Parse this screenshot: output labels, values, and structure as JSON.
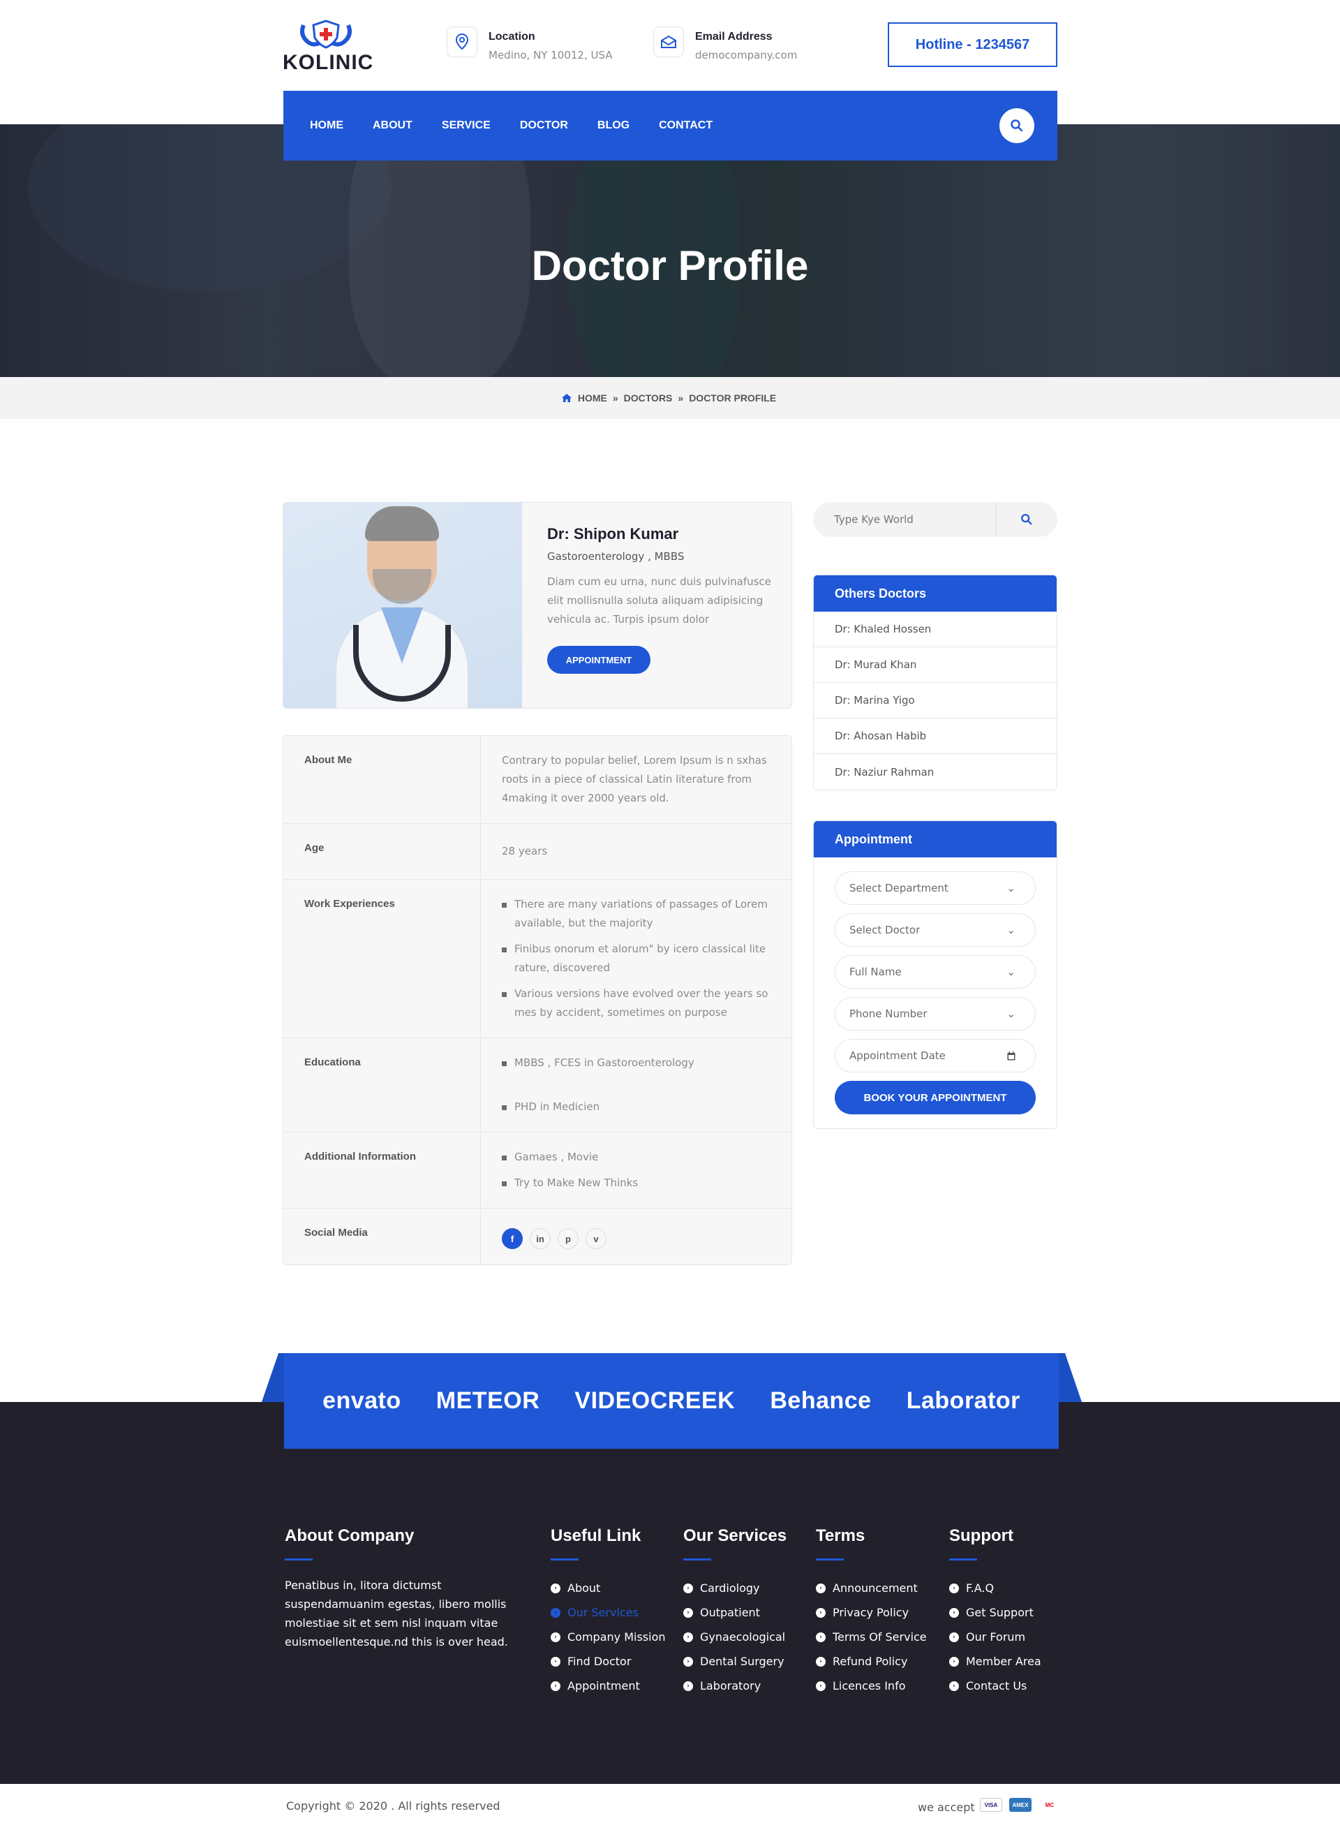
{
  "brand": {
    "logo_text": "KOLINIC",
    "accent": "#1f57d6"
  },
  "header": {
    "location_title": "Location",
    "location_value": "Medino, NY 10012, USA",
    "email_title": "Email Address",
    "email_value": "democompany.com",
    "hotline": "Hotline - 1234567"
  },
  "nav": {
    "items": [
      "HOME",
      "ABOUT",
      "SERVICE",
      "DOCTOR",
      "BLOG",
      "CONTACT"
    ]
  },
  "hero": {
    "title": "Doctor Profile"
  },
  "breadcrumb": {
    "home": "HOME",
    "sep": "»",
    "doctors": "DOCTORS",
    "current": "DOCTOR PROFILE"
  },
  "profile": {
    "name": "Dr: Shipon Kumar",
    "specialty": "Gastoroenterology , MBBS",
    "description": "Diam cum eu urna, nunc duis pulvinafusce elit mollisnulla soluta aliquam adipisicing vehicula ac. Turpis ipsum dolor",
    "button": "APPOINTMENT"
  },
  "details": {
    "about_label": "About Me",
    "about_value": "Contrary to popular belief, Lorem Ipsum is n sxhas roots in a piece of classical Latin literature from 4making it over 2000 years old.",
    "age_label": "Age",
    "age_value": "28 years",
    "work_label": "Work Experiences",
    "work_items": [
      "There are many variations of passages of Lorem available, but the majority",
      "Finibus onorum et alorum\"  by icero classical lite rature, discovered",
      "Various versions have evolved over the years so mes by accident, sometimes on purpose"
    ],
    "education_label": "Educationa",
    "education_items": [
      "MBBS , FCES in Gastoroenterology",
      "PHD in Medicien"
    ],
    "additional_label": "Additional Information",
    "additional_items": [
      "Gamaes , Movie",
      "Try to Make New Thinks"
    ],
    "social_label": "Social Media",
    "social_icons": [
      "f",
      "in",
      "p",
      "v"
    ]
  },
  "sidebar": {
    "search_placeholder": "Type Kye World",
    "others_title": "Others Doctors",
    "doctors": [
      "Dr: Khaled Hossen",
      "Dr: Murad Khan",
      "Dr: Marina Yigo",
      "Dr: Ahosan Habib",
      "Dr: Naziur Rahman"
    ],
    "appointment_title": "Appointment",
    "fields": [
      "Select Department",
      "Select Doctor",
      "Full Name",
      "Phone Number",
      "Appointment Date"
    ],
    "book_button": "BOOK YOUR  APPOINTMENT"
  },
  "partners": [
    "envato",
    "METEOR",
    "VIDEOCREEK",
    "Behance",
    "Laborator"
  ],
  "footer": {
    "about_title": "About Company",
    "about_text": "Penatibus in, litora dictumst suspendamuanim egestas, libero mollis molestiae sit et sem nisl inquam vitae euismoellentesque.nd this is over head.",
    "useful_title": "Useful Link",
    "useful_links": [
      "About",
      "Our Services",
      "Company Mission",
      "Find Doctor",
      "Appointment"
    ],
    "services_title": "Our Services",
    "services_links": [
      "Cardiology",
      "Outpatient",
      "Gynaecological",
      "Dental Surgery",
      "Laboratory"
    ],
    "terms_title": "Terms",
    "terms_links": [
      "Announcement",
      "Privacy Policy",
      "Terms Of Service",
      "Refund Policy",
      "Licences Info"
    ],
    "support_title": "Support",
    "support_links": [
      "F.A.Q",
      "Get Support",
      "Our Forum",
      "Member Area",
      "Contact Us"
    ]
  },
  "bottom": {
    "copyright": "Copyright © 2020 . All rights reserved",
    "we_accept": "we accept",
    "cards": [
      "VISA",
      "AMEX",
      "MC"
    ]
  }
}
